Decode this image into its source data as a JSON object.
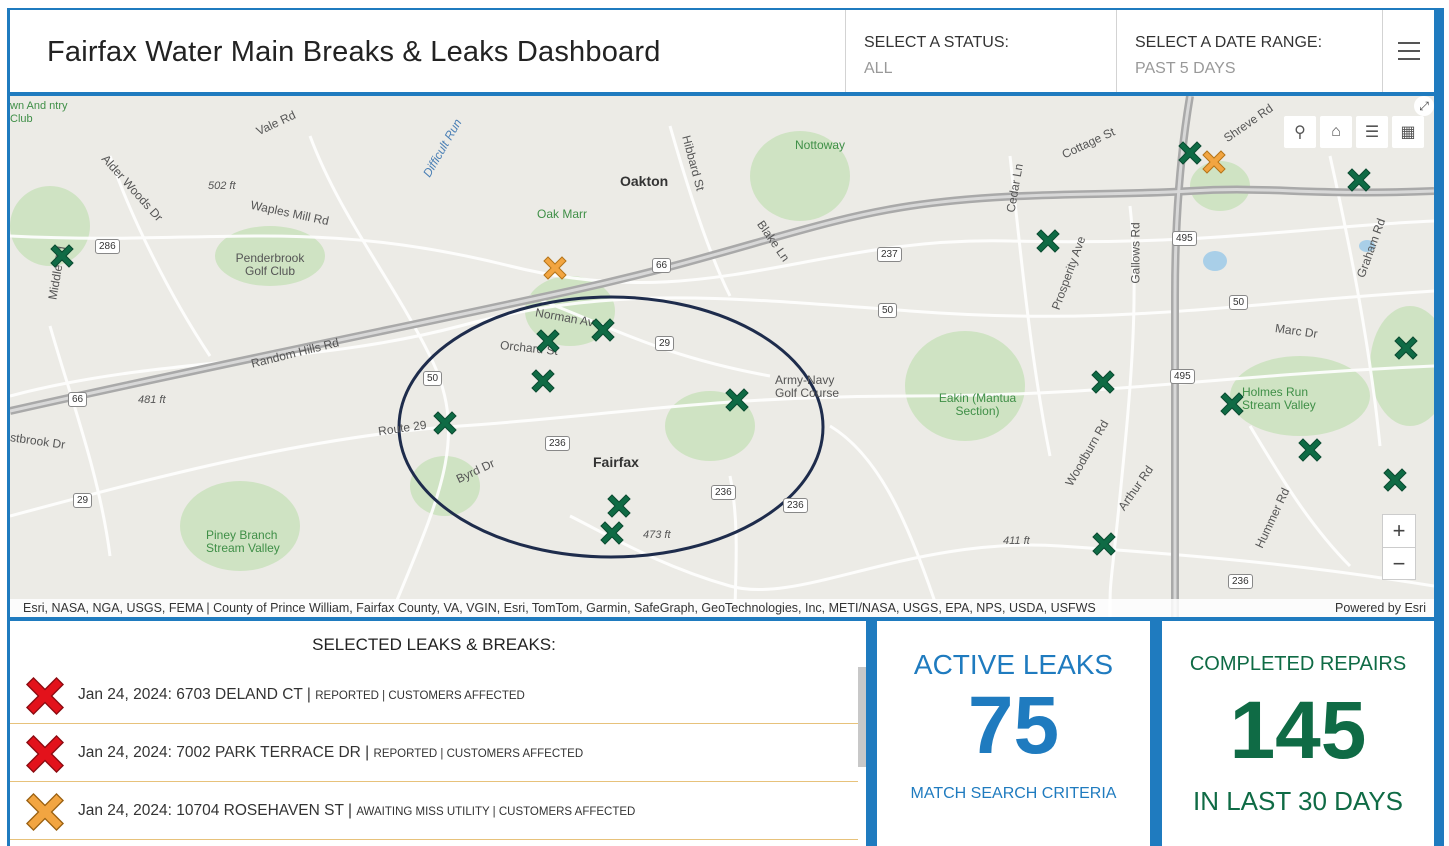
{
  "header": {
    "title": "Fairfax Water Main Breaks & Leaks Dashboard",
    "status_filter": {
      "label": "SELECT A STATUS:",
      "value": "ALL"
    },
    "date_filter": {
      "label": "SELECT A DATE RANGE:",
      "value": "PAST 5 DAYS"
    }
  },
  "map": {
    "labels": {
      "oakton": "Oakton",
      "fairfax": "Fairfax",
      "nottoway": "Nottoway",
      "oak_marr": "Oak Marr",
      "penderbrook": "Penderbrook Golf Club",
      "army_navy": "Army-Navy Golf Course",
      "eakin": "Eakin (Mantua Section)",
      "holmes_run": "Holmes Run Stream Valley",
      "piney_branch": "Piney Branch Stream Valley",
      "country_club": "wn And ntry Club",
      "vale_rd": "Vale Rd",
      "waples_mill": "Waples Mill Rd",
      "alder_woods": "Alder Woods Dr",
      "difficult_run": "Difficult Run",
      "random_hills": "Random Hills Rd",
      "route_29": "Route 29",
      "byrd_dr": "Byrd Dr",
      "norman_ave": "Norman Ave",
      "orchard_st": "Orchard St",
      "blake_ln": "Blake Ln",
      "hibbard_st": "Hibbard St",
      "cottage_st": "Cottage St",
      "cedar_ln": "Cedar Ln",
      "prosperity_ave": "Prosperity Ave",
      "gallows_rd": "Gallows Rd",
      "marc_dr": "Marc Dr",
      "graham_rd": "Graham Rd",
      "woodburn_rd": "Woodburn Rd",
      "arthur_rd": "Arthur Rd",
      "hummer_rd": "Hummer Rd",
      "shreve_rd": "Shreve Rd",
      "elev_502": "502 ft",
      "elev_481": "481 ft",
      "elev_473": "473 ft",
      "elev_411": "411 ft",
      "middle_rd": "Middle Rd",
      "westbrook_dr": "stbrook Dr"
    },
    "shields": {
      "r286": "286",
      "r66a": "66",
      "r66b": "66",
      "r66c": "66",
      "r50a": "50",
      "r50b": "50",
      "r50c": "50",
      "r29a": "29",
      "r29b": "29",
      "r237": "237",
      "r495a": "495",
      "r495b": "495",
      "r236a": "236",
      "r236b": "236",
      "r236c": "236",
      "r236d": "236"
    },
    "tools": [
      "search-icon",
      "home-icon",
      "list-icon",
      "basemap-icon"
    ],
    "attribution": "Esri, NASA, NGA, USGS, FEMA | County of Prince William, Fairfax County, VA, VGIN, Esri, TomTom, Garmin, SafeGraph, GeoTechnologies, Inc, METI/NASA, USGS, EPA, NPS, USDA, USFWS",
    "powered_by": "Powered by Esri",
    "zoom_in": "+",
    "zoom_out": "−",
    "marker_colors": {
      "green": "#0f6b45",
      "orange": "#f2a541",
      "red": "#e3121b"
    }
  },
  "selected_list": {
    "title": "SELECTED LEAKS & BREAKS:",
    "items": [
      {
        "date_address": "Jan 24, 2024: 6703 DELAND CT",
        "status": "REPORTED",
        "impact": "CUSTOMERS AFFECTED",
        "icon_color": "red"
      },
      {
        "date_address": "Jan 24, 2024: 7002 PARK TERRACE DR",
        "status": "REPORTED",
        "impact": "CUSTOMERS AFFECTED",
        "icon_color": "red"
      },
      {
        "date_address": "Jan 24, 2024: 10704 ROSEHAVEN ST",
        "status": "AWAITING MISS UTILITY",
        "impact": "CUSTOMERS AFFECTED",
        "icon_color": "orange"
      }
    ]
  },
  "active_leaks": {
    "label": "ACTIVE LEAKS",
    "value": "75",
    "sublabel": "MATCH SEARCH CRITERIA",
    "color": "#1f7bbf"
  },
  "completed_repairs": {
    "label": "COMPLETED REPAIRS",
    "value": "145",
    "sublabel": "IN LAST 30 DAYS",
    "color": "#0f6b45"
  }
}
